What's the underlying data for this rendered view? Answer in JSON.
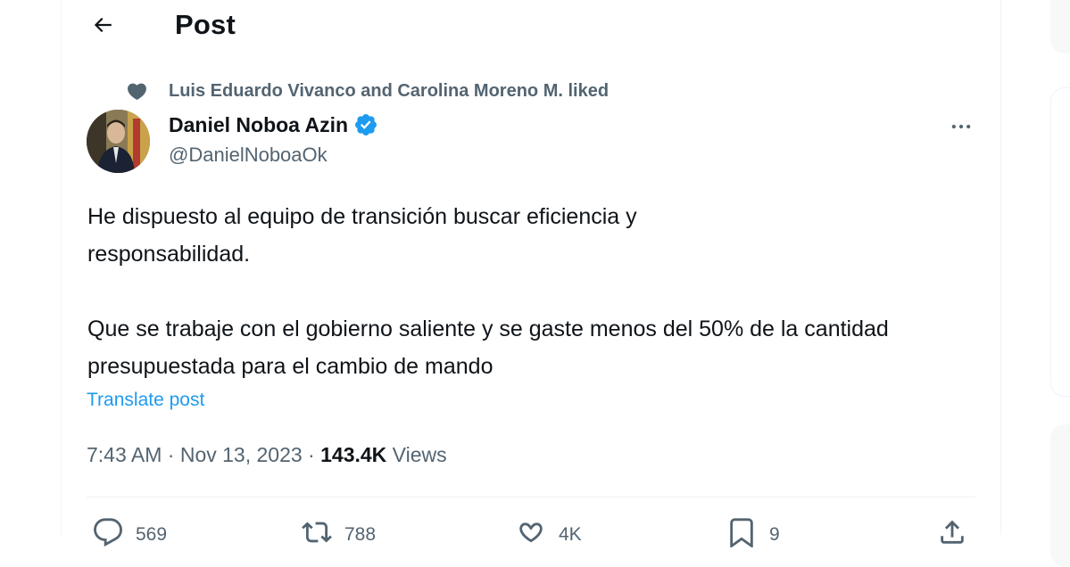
{
  "header": {
    "back_icon": "arrow-left-icon",
    "title": "Post"
  },
  "social_context": {
    "icon": "heart-icon",
    "text": "Luis Eduardo Vivanco and Carolina Moreno M. liked"
  },
  "author": {
    "name": "Daniel Noboa Azin",
    "handle": "@DanielNoboaOk",
    "verified_color": "#1d9bf0"
  },
  "tweet": {
    "paragraph1": "He dispuesto al equipo de transición  buscar eficiencia y responsabilidad.",
    "paragraph2": "Que se trabaje con el gobierno saliente y se gaste menos del 50% de la cantidad presupuestada para el cambio de mando",
    "translate_label": "Translate post"
  },
  "meta": {
    "time": "7:43 AM",
    "separator": " · ",
    "date": "Nov 13, 2023",
    "views_count": "143.4K",
    "views_label": " Views"
  },
  "actions": {
    "replies": "569",
    "reposts": "788",
    "likes": "4K",
    "bookmarks": "9"
  },
  "colors": {
    "accent": "#1d9bf0",
    "text_primary": "#0f1419",
    "text_secondary": "#536471"
  }
}
